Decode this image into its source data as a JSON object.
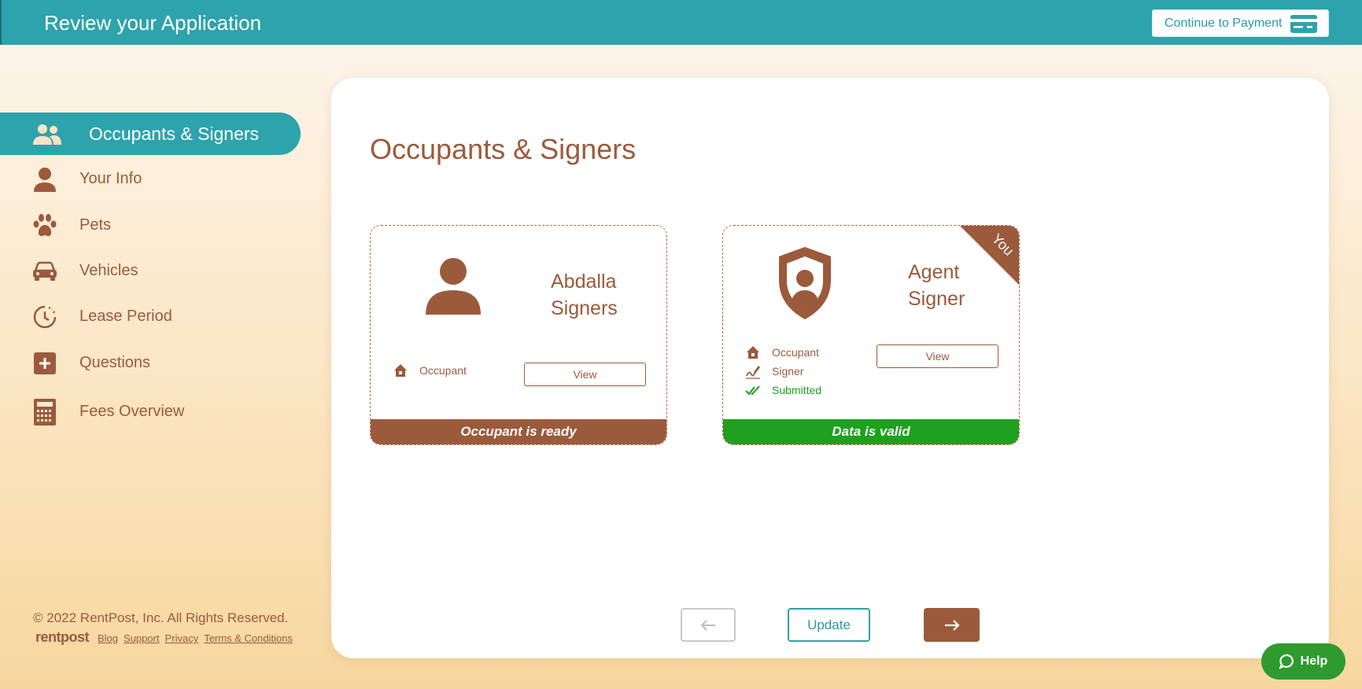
{
  "header": {
    "title": "Review your Application",
    "continue_label": "Continue to Payment"
  },
  "sidebar": {
    "items": [
      {
        "label": "Occupants & Signers",
        "icon": "people-icon",
        "active": true
      },
      {
        "label": "Your Info",
        "icon": "user-icon"
      },
      {
        "label": "Pets",
        "icon": "paw-icon"
      },
      {
        "label": "Vehicles",
        "icon": "car-icon"
      },
      {
        "label": "Lease Period",
        "icon": "clock-icon"
      },
      {
        "label": "Questions",
        "icon": "plus-square-icon"
      },
      {
        "label": "Fees Overview",
        "icon": "calculator-icon"
      }
    ]
  },
  "footer": {
    "copyright": "© 2022 RentPost, Inc. All Rights Reserved.",
    "logo": "rentpost",
    "links": [
      "Blog",
      "Support",
      "Privacy",
      "Terms & Conditions"
    ]
  },
  "main": {
    "title": "Occupants & Signers",
    "cards": [
      {
        "name_line1": "Abdalla",
        "name_line2": "Signers",
        "icon": "person-icon",
        "roles": [
          {
            "label": "Occupant",
            "icon": "house-icon"
          }
        ],
        "view_label": "View",
        "status": "Occupant is ready"
      },
      {
        "name_line1": "Agent",
        "name_line2": "Signer",
        "icon": "shield-person-icon",
        "ribbon": "You",
        "roles": [
          {
            "label": "Occupant",
            "icon": "house-icon"
          },
          {
            "label": "Signer",
            "icon": "signature-icon"
          },
          {
            "label": "Submitted",
            "icon": "double-check-icon"
          }
        ],
        "view_label": "View",
        "status": "Data is valid"
      }
    ],
    "update_label": "Update"
  },
  "help": {
    "label": "Help"
  },
  "colors": {
    "teal": "#2da3ab",
    "brown": "#9b5a3c",
    "green": "#1ca11c"
  }
}
